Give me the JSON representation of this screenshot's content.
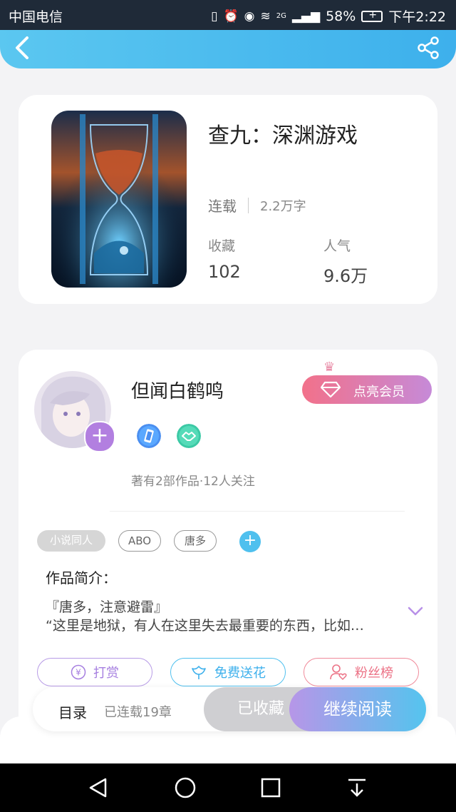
{
  "status_bar": {
    "carrier": "中国电信",
    "network": "2G",
    "battery": "58%",
    "time": "下午2:22"
  },
  "header": {
    "back_icon": "chevron-left-icon",
    "share_icon": "share-icon"
  },
  "book": {
    "title": "查九：深渊游戏",
    "status": "连载",
    "word_count": "2.2万字",
    "favorites_label": "收藏",
    "favorites_value": "102",
    "popularity_label": "人气",
    "popularity_value": "9.6万"
  },
  "author": {
    "name": "但闻白鹤鸣",
    "vip_button": "点亮会员",
    "meta": "著有2部作品·12人关注"
  },
  "tags": [
    "小说同人",
    "ABO",
    "唐多"
  ],
  "intro": {
    "label": "作品简介：",
    "line1": "『唐多，注意避雷』",
    "line2": "“这里是地狱，有人在这里失去最重要的东西，比如…"
  },
  "actions": {
    "reward": "打赏",
    "flower": "免费送花",
    "fans": "粉丝榜"
  },
  "bottom_bar": {
    "toc": "目录",
    "chapters": "已连载19章",
    "collected": "已收藏",
    "continue": "继续阅读"
  },
  "colors": {
    "accent_blue": "#3db0ec",
    "accent_purple": "#b27fe0",
    "accent_pink": "#f2718a"
  }
}
